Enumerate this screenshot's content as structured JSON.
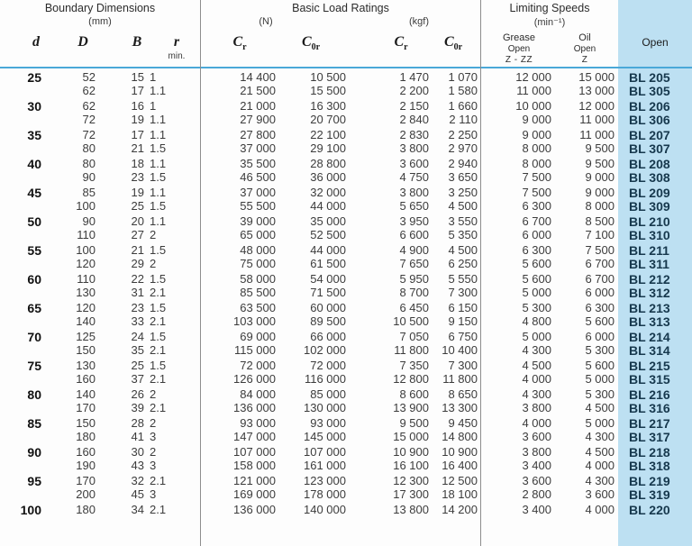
{
  "header": {
    "groups": [
      {
        "title": "Boundary Dimensions",
        "unit": "(mm)"
      },
      {
        "title": "Basic Load Ratings",
        "unit_left": "(N)",
        "unit_right": "(kgf)"
      },
      {
        "title": "Limiting Speeds",
        "unit": "(min⁻¹)"
      }
    ],
    "columns": {
      "d": "d",
      "D": "D",
      "B": "B",
      "r": "r",
      "r_note": "min.",
      "cr_n": "C",
      "cr_n_sub": "r",
      "c0r_n": "C",
      "c0r_n_sub": "0r",
      "cr_kgf": "C",
      "cr_kgf_sub": "r",
      "c0r_kgf": "C",
      "c0r_kgf_sub": "0r",
      "grease": {
        "l1": "Grease",
        "l2": "Open",
        "l3": "Z - ZZ"
      },
      "oil": {
        "l1": "Oil",
        "l2": "Open",
        "l3": "Z"
      },
      "open": "Open"
    }
  },
  "colors": {
    "panel_blue": "#bde0f2",
    "rule_blue": "#4aa8d8",
    "designation_text": "#16384d",
    "divider": "#8d8d8d"
  },
  "rows": [
    {
      "d": "25",
      "lines": [
        {
          "D": "52",
          "B": "15",
          "r": "1",
          "cr_n": "14 400",
          "c0r_n": "10 500",
          "cr_kgf": "1 470",
          "c0r_kgf": "1 070",
          "grease": "12 000",
          "oil": "15 000",
          "desig": "BL 205"
        },
        {
          "D": "62",
          "B": "17",
          "r": "1.1",
          "cr_n": "21 500",
          "c0r_n": "15 500",
          "cr_kgf": "2 200",
          "c0r_kgf": "1 580",
          "grease": "11 000",
          "oil": "13 000",
          "desig": "BL 305"
        }
      ]
    },
    {
      "d": "30",
      "lines": [
        {
          "D": "62",
          "B": "16",
          "r": "1",
          "cr_n": "21 000",
          "c0r_n": "16 300",
          "cr_kgf": "2 150",
          "c0r_kgf": "1 660",
          "grease": "10 000",
          "oil": "12 000",
          "desig": "BL 206"
        },
        {
          "D": "72",
          "B": "19",
          "r": "1.1",
          "cr_n": "27 900",
          "c0r_n": "20 700",
          "cr_kgf": "2 840",
          "c0r_kgf": "2 110",
          "grease": "9 000",
          "oil": "11 000",
          "desig": "BL 306"
        }
      ]
    },
    {
      "d": "35",
      "lines": [
        {
          "D": "72",
          "B": "17",
          "r": "1.1",
          "cr_n": "27 800",
          "c0r_n": "22 100",
          "cr_kgf": "2 830",
          "c0r_kgf": "2 250",
          "grease": "9 000",
          "oil": "11 000",
          "desig": "BL 207"
        },
        {
          "D": "80",
          "B": "21",
          "r": "1.5",
          "cr_n": "37 000",
          "c0r_n": "29 100",
          "cr_kgf": "3 800",
          "c0r_kgf": "2 970",
          "grease": "8 000",
          "oil": "9 500",
          "desig": "BL 307"
        }
      ]
    },
    {
      "d": "40",
      "lines": [
        {
          "D": "80",
          "B": "18",
          "r": "1.1",
          "cr_n": "35 500",
          "c0r_n": "28 800",
          "cr_kgf": "3 600",
          "c0r_kgf": "2 940",
          "grease": "8 000",
          "oil": "9 500",
          "desig": "BL 208"
        },
        {
          "D": "90",
          "B": "23",
          "r": "1.5",
          "cr_n": "46 500",
          "c0r_n": "36 000",
          "cr_kgf": "4 750",
          "c0r_kgf": "3 650",
          "grease": "7 500",
          "oil": "9 000",
          "desig": "BL 308"
        }
      ]
    },
    {
      "d": "45",
      "lines": [
        {
          "D": "85",
          "B": "19",
          "r": "1.1",
          "cr_n": "37 000",
          "c0r_n": "32 000",
          "cr_kgf": "3 800",
          "c0r_kgf": "3 250",
          "grease": "7 500",
          "oil": "9 000",
          "desig": "BL 209"
        },
        {
          "D": "100",
          "B": "25",
          "r": "1.5",
          "cr_n": "55 500",
          "c0r_n": "44 000",
          "cr_kgf": "5 650",
          "c0r_kgf": "4 500",
          "grease": "6 300",
          "oil": "8 000",
          "desig": "BL 309"
        }
      ]
    },
    {
      "d": "50",
      "lines": [
        {
          "D": "90",
          "B": "20",
          "r": "1.1",
          "cr_n": "39 000",
          "c0r_n": "35 000",
          "cr_kgf": "3 950",
          "c0r_kgf": "3 550",
          "grease": "6 700",
          "oil": "8 500",
          "desig": "BL 210"
        },
        {
          "D": "110",
          "B": "27",
          "r": "2",
          "cr_n": "65 000",
          "c0r_n": "52 500",
          "cr_kgf": "6 600",
          "c0r_kgf": "5 350",
          "grease": "6 000",
          "oil": "7 100",
          "desig": "BL 310"
        }
      ]
    },
    {
      "d": "55",
      "lines": [
        {
          "D": "100",
          "B": "21",
          "r": "1.5",
          "cr_n": "48 000",
          "c0r_n": "44 000",
          "cr_kgf": "4 900",
          "c0r_kgf": "4 500",
          "grease": "6 300",
          "oil": "7 500",
          "desig": "BL 211"
        },
        {
          "D": "120",
          "B": "29",
          "r": "2",
          "cr_n": "75 000",
          "c0r_n": "61 500",
          "cr_kgf": "7 650",
          "c0r_kgf": "6 250",
          "grease": "5 600",
          "oil": "6 700",
          "desig": "BL 311"
        }
      ]
    },
    {
      "d": "60",
      "lines": [
        {
          "D": "110",
          "B": "22",
          "r": "1.5",
          "cr_n": "58 000",
          "c0r_n": "54 000",
          "cr_kgf": "5 950",
          "c0r_kgf": "5 550",
          "grease": "5 600",
          "oil": "6 700",
          "desig": "BL 212"
        },
        {
          "D": "130",
          "B": "31",
          "r": "2.1",
          "cr_n": "85 500",
          "c0r_n": "71 500",
          "cr_kgf": "8 700",
          "c0r_kgf": "7 300",
          "grease": "5 000",
          "oil": "6 000",
          "desig": "BL 312"
        }
      ]
    },
    {
      "d": "65",
      "lines": [
        {
          "D": "120",
          "B": "23",
          "r": "1.5",
          "cr_n": "63 500",
          "c0r_n": "60 000",
          "cr_kgf": "6 450",
          "c0r_kgf": "6 150",
          "grease": "5 300",
          "oil": "6 300",
          "desig": "BL 213"
        },
        {
          "D": "140",
          "B": "33",
          "r": "2.1",
          "cr_n": "103 000",
          "c0r_n": "89 500",
          "cr_kgf": "10 500",
          "c0r_kgf": "9 150",
          "grease": "4 800",
          "oil": "5 600",
          "desig": "BL 313"
        }
      ]
    },
    {
      "d": "70",
      "lines": [
        {
          "D": "125",
          "B": "24",
          "r": "1.5",
          "cr_n": "69 000",
          "c0r_n": "66 000",
          "cr_kgf": "7 050",
          "c0r_kgf": "6 750",
          "grease": "5 000",
          "oil": "6 000",
          "desig": "BL 214"
        },
        {
          "D": "150",
          "B": "35",
          "r": "2.1",
          "cr_n": "115 000",
          "c0r_n": "102 000",
          "cr_kgf": "11 800",
          "c0r_kgf": "10 400",
          "grease": "4 300",
          "oil": "5 300",
          "desig": "BL 314"
        }
      ]
    },
    {
      "d": "75",
      "lines": [
        {
          "D": "130",
          "B": "25",
          "r": "1.5",
          "cr_n": "72 000",
          "c0r_n": "72 000",
          "cr_kgf": "7 350",
          "c0r_kgf": "7 300",
          "grease": "4 500",
          "oil": "5 600",
          "desig": "BL 215"
        },
        {
          "D": "160",
          "B": "37",
          "r": "2.1",
          "cr_n": "126 000",
          "c0r_n": "116 000",
          "cr_kgf": "12 800",
          "c0r_kgf": "11 800",
          "grease": "4 000",
          "oil": "5 000",
          "desig": "BL 315"
        }
      ]
    },
    {
      "d": "80",
      "lines": [
        {
          "D": "140",
          "B": "26",
          "r": "2",
          "cr_n": "84 000",
          "c0r_n": "85 000",
          "cr_kgf": "8 600",
          "c0r_kgf": "8 650",
          "grease": "4 300",
          "oil": "5 300",
          "desig": "BL 216"
        },
        {
          "D": "170",
          "B": "39",
          "r": "2.1",
          "cr_n": "136 000",
          "c0r_n": "130 000",
          "cr_kgf": "13 900",
          "c0r_kgf": "13 300",
          "grease": "3 800",
          "oil": "4 500",
          "desig": "BL 316"
        }
      ]
    },
    {
      "d": "85",
      "lines": [
        {
          "D": "150",
          "B": "28",
          "r": "2",
          "cr_n": "93 000",
          "c0r_n": "93 000",
          "cr_kgf": "9 500",
          "c0r_kgf": "9 450",
          "grease": "4 000",
          "oil": "5 000",
          "desig": "BL 217"
        },
        {
          "D": "180",
          "B": "41",
          "r": "3",
          "cr_n": "147 000",
          "c0r_n": "145 000",
          "cr_kgf": "15 000",
          "c0r_kgf": "14 800",
          "grease": "3 600",
          "oil": "4 300",
          "desig": "BL 317"
        }
      ]
    },
    {
      "d": "90",
      "lines": [
        {
          "D": "160",
          "B": "30",
          "r": "2",
          "cr_n": "107 000",
          "c0r_n": "107 000",
          "cr_kgf": "10 900",
          "c0r_kgf": "10 900",
          "grease": "3 800",
          "oil": "4 500",
          "desig": "BL 218"
        },
        {
          "D": "190",
          "B": "43",
          "r": "3",
          "cr_n": "158 000",
          "c0r_n": "161 000",
          "cr_kgf": "16 100",
          "c0r_kgf": "16 400",
          "grease": "3 400",
          "oil": "4 000",
          "desig": "BL 318"
        }
      ]
    },
    {
      "d": "95",
      "lines": [
        {
          "D": "170",
          "B": "32",
          "r": "2.1",
          "cr_n": "121 000",
          "c0r_n": "123 000",
          "cr_kgf": "12 300",
          "c0r_kgf": "12 500",
          "grease": "3 600",
          "oil": "4 300",
          "desig": "BL 219"
        },
        {
          "D": "200",
          "B": "45",
          "r": "3",
          "cr_n": "169 000",
          "c0r_n": "178 000",
          "cr_kgf": "17 300",
          "c0r_kgf": "18 100",
          "grease": "2 800",
          "oil": "3 600",
          "desig": "BL 319"
        }
      ]
    },
    {
      "d": "100",
      "lines": [
        {
          "D": "180",
          "B": "34",
          "r": "2.1",
          "cr_n": "136 000",
          "c0r_n": "140 000",
          "cr_kgf": "13 800",
          "c0r_kgf": "14 200",
          "grease": "3 400",
          "oil": "4 000",
          "desig": "BL 220"
        }
      ]
    }
  ]
}
